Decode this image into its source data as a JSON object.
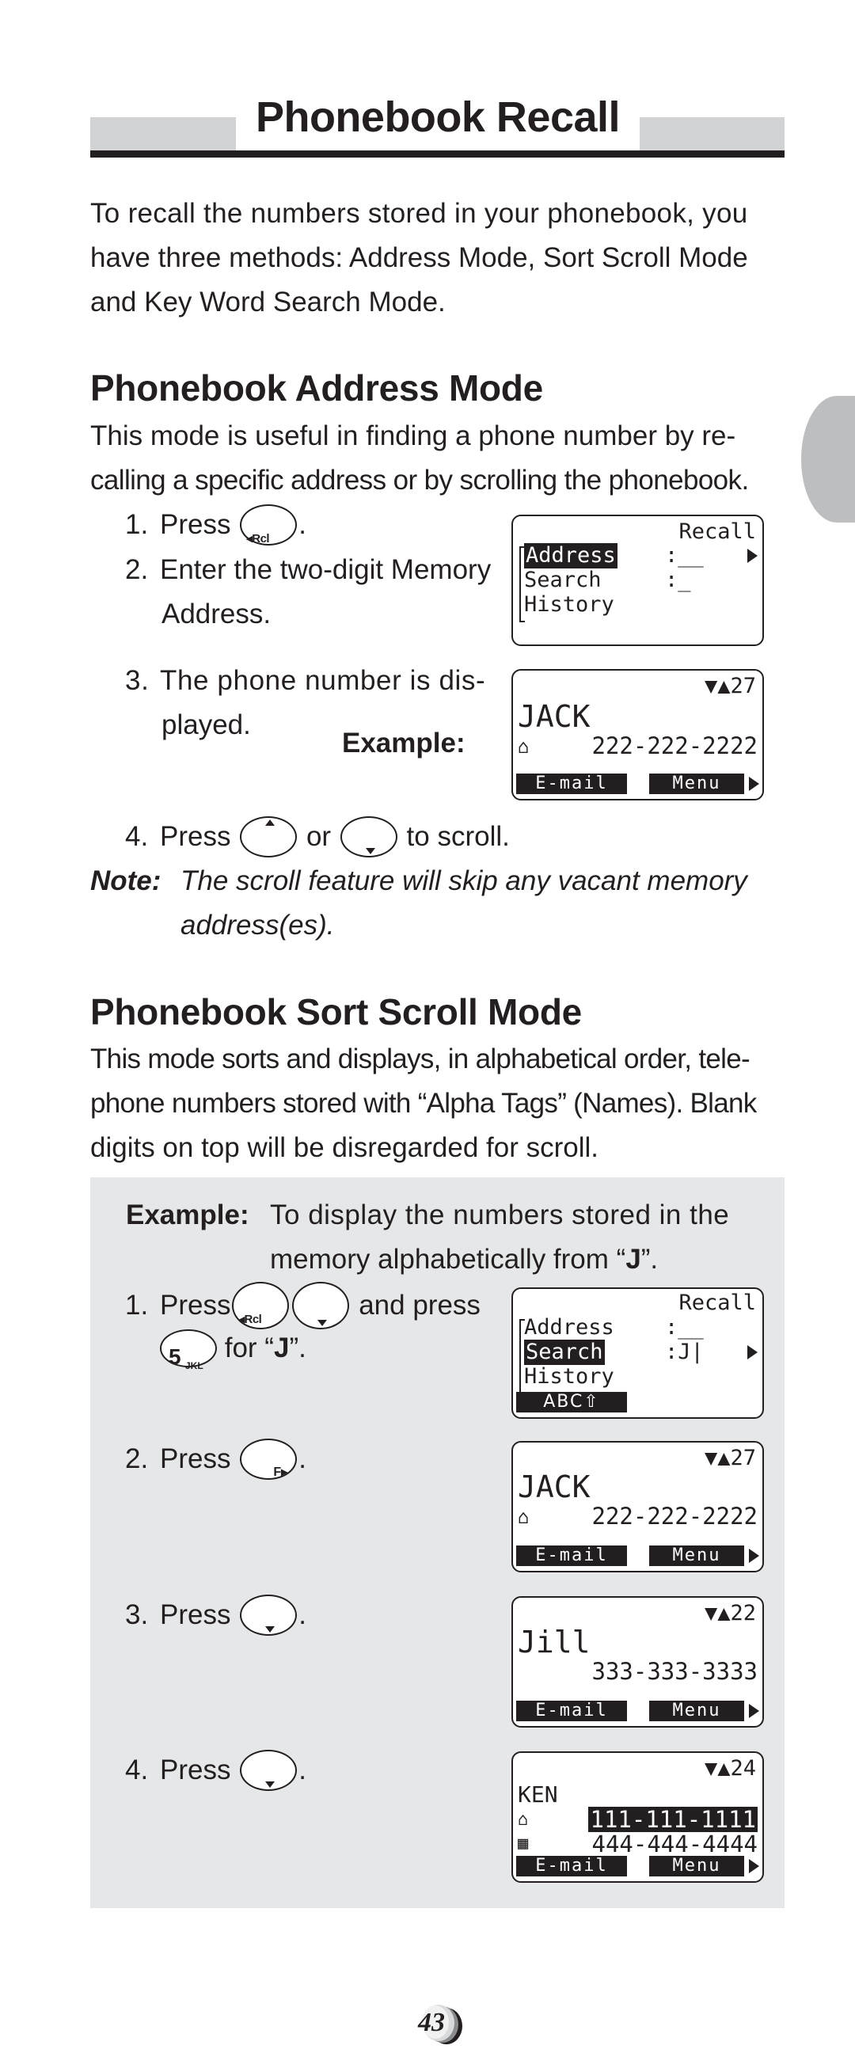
{
  "header": {
    "title": "Phonebook Recall"
  },
  "intro": {
    "lines": [
      "To recall the numbers stored in your phonebook, you",
      "have three methods: Address Mode, Sort Scroll Mode",
      "and Key Word Search Mode."
    ]
  },
  "address_mode": {
    "heading": "Phonebook Address Mode",
    "lines": [
      "This mode is useful in finding a phone number by re-",
      "calling a specific address or by scrolling the phonebook."
    ],
    "steps": [
      {
        "num": "1.",
        "pre": "Press",
        "post": "."
      },
      {
        "num": "2.",
        "text": "Enter the two-digit Memory",
        "text2": "Address."
      },
      {
        "num": "3.",
        "text": "The phone number is dis-",
        "text2": "played."
      },
      {
        "num": "4.",
        "pre": "Press",
        "mid": "or",
        "post": "to scroll."
      }
    ],
    "example_label": "Example:",
    "note_label": "Note:",
    "note_lines": [
      "The scroll feature will skip any vacant memory",
      "address(es)."
    ],
    "lcd_recall": {
      "title": "Recall",
      "items": [
        {
          "label": "Address",
          "value": ":__",
          "selected": true
        },
        {
          "label": "Search",
          "value": ":_",
          "selected": false
        },
        {
          "label": "History",
          "value": "",
          "selected": false
        }
      ]
    },
    "lcd_entry": {
      "counter": "▼▲27",
      "name": "JACK",
      "phone": "222-222-2222",
      "softkeys": [
        "E-mail",
        "Menu"
      ]
    }
  },
  "sort_mode": {
    "heading": "Phonebook Sort Scroll Mode",
    "lines": [
      "This mode sorts and displays, in alphabetical order, tele-",
      "phone numbers stored with “Alpha Tags” (Names). Blank",
      "digits on top will be disregarded for scroll."
    ],
    "example_label": "Example:",
    "example_lines": [
      "To display the numbers stored in the",
      "memory alphabetically from “",
      "J",
      "”."
    ],
    "steps": [
      {
        "num": "1.",
        "pre": "Press",
        "post": "and press",
        "line2_post": "for “",
        "line2_bold": "J",
        "line2_end": "”."
      },
      {
        "num": "2.",
        "pre": "Press",
        "post": "."
      },
      {
        "num": "3.",
        "pre": "Press",
        "post": "."
      },
      {
        "num": "4.",
        "pre": "Press",
        "post": "."
      }
    ],
    "lcd_search": {
      "title": "Recall",
      "items": [
        {
          "label": "Address",
          "value": ":__",
          "selected": false
        },
        {
          "label": "Search",
          "value": ":J|",
          "selected": true
        },
        {
          "label": "History",
          "value": "",
          "selected": false
        }
      ],
      "mode": "ABC⇧"
    },
    "lcd_jack": {
      "counter": "▼▲27",
      "name": "JACK",
      "phone": "222-222-2222",
      "softkeys": [
        "E-mail",
        "Menu"
      ]
    },
    "lcd_jill": {
      "counter": "▼▲22",
      "name": "Jill",
      "phone": "333-333-3333",
      "softkeys": [
        "E-mail",
        "Menu"
      ]
    },
    "lcd_ken": {
      "counter": "▼▲24",
      "name": "KEN",
      "phone_home": "111-111-1111",
      "phone_office": "444-444-4444",
      "softkeys": [
        "E-mail",
        "Menu"
      ]
    }
  },
  "keys": {
    "rcl": "Rcl",
    "f": "F",
    "five_digit": "5",
    "five_letters": "JKL"
  },
  "footer": {
    "page_number": "43"
  }
}
